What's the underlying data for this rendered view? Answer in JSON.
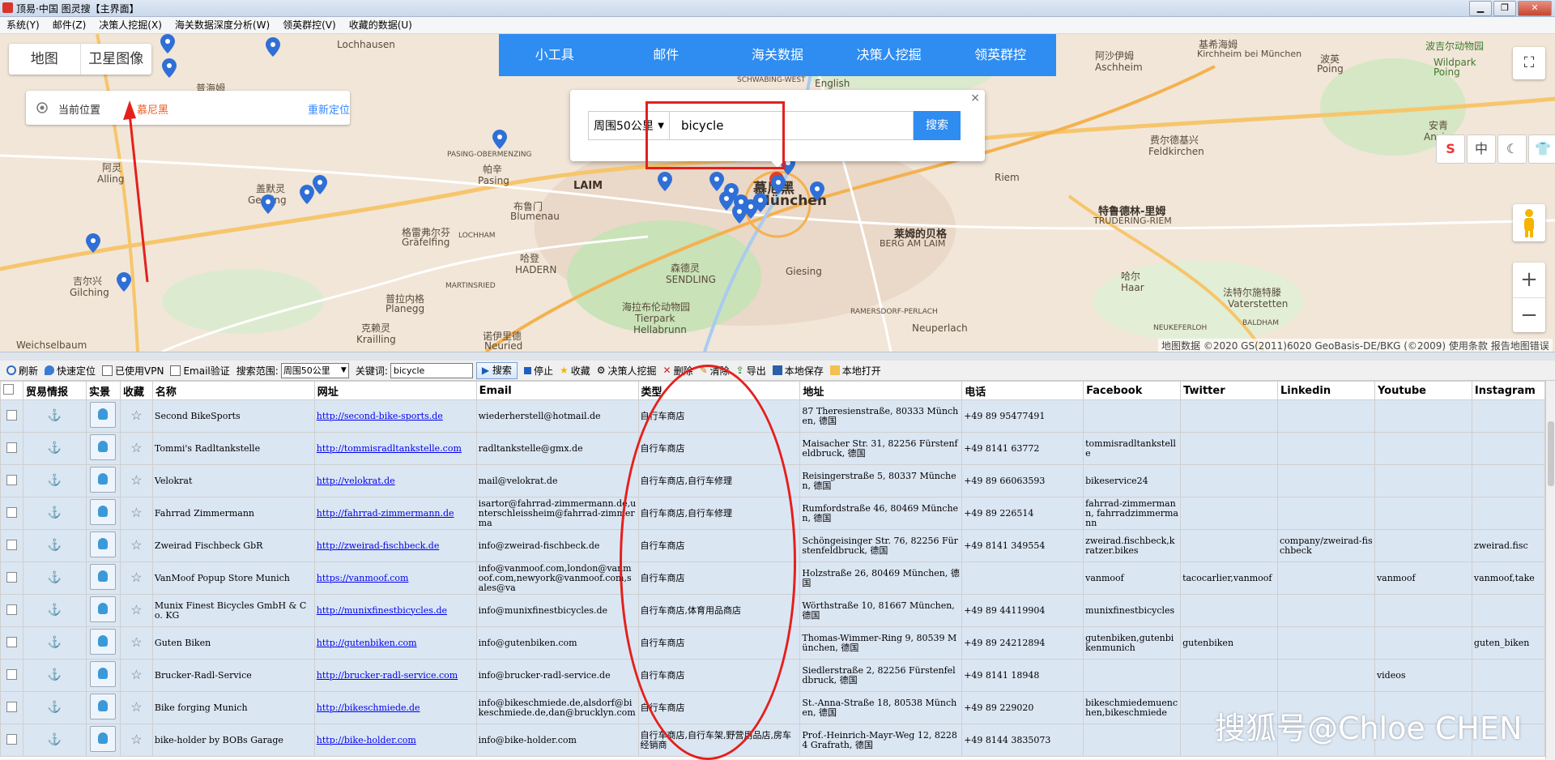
{
  "window": {
    "title": "顶易·中国 图灵搜【主界面】",
    "btn_min": "▁",
    "btn_max": "❐",
    "btn_close": "✕"
  },
  "menu": [
    "系统(Y)",
    "邮件(Z)",
    "决策人挖掘(X)",
    "海关数据深度分析(W)",
    "领英群控(V)",
    "收藏的数据(U)"
  ],
  "map": {
    "type_tabs": [
      "地图",
      "卫星图像"
    ],
    "location_label": "当前位置",
    "location_value": "慕尼黑",
    "relocate": "重新定位",
    "top_nav": [
      "小工具",
      "邮件",
      "海关数据",
      "决策人挖掘",
      "领英群控"
    ],
    "search": {
      "scope": "周围50公里",
      "keyword": "bicycle",
      "button": "搜索",
      "close": "×"
    },
    "side_buttons": [
      "S",
      "中",
      "☾",
      "👕"
    ],
    "zoom_in": "+",
    "zoom_out": "−",
    "fullscreen": "⛶",
    "copyright": "地图数据 ©2020 GS(2011)6020 GeoBasis-DE/BKG (©2009)   使用条款   报告地图错误",
    "labels": [
      "Lochhausen",
      "普海姆",
      "阿灵",
      "Alling",
      "盖默灵",
      "Gerning",
      "吉尔兴",
      "Gilching",
      "Weichselbaum",
      "PASING-OBERMENZING",
      "帕辛",
      "Pasing",
      "LAIM",
      "布鲁门",
      "Blumenau",
      "格雷弗尔芬",
      "Gräfelfing",
      "LOCHHAM",
      "哈登",
      "HADERN",
      "MARTINSRIED",
      "普拉内格",
      "Planegg",
      "克赖灵",
      "Krailling",
      "诺伊里德",
      "Neuried",
      "森德灵",
      "SENDLING",
      "海拉布伦动物园",
      "Tierpark",
      "Hellabrunn",
      "Giesing",
      "慕尼黑",
      "München",
      "SCHWABING-WEST",
      "English",
      "阿沙伊姆",
      "Aschheim",
      "基希海姆",
      "Kirchheim bei München",
      "波英",
      "Poing",
      "费尔德基兴",
      "Feldkirchen",
      "Riem",
      "特鲁德林-里姆",
      "TRUDERING-RIEM",
      "莱姆的贝格",
      "BERG AM LAIM",
      "哈尔",
      "Haar",
      "法特尔施特滕",
      "Vaterstetten",
      "RAMERSDORF-PERLACH",
      "Neuperlach",
      "NEUKEFERLOH",
      "BALDHAM",
      "安青",
      "Anzing",
      "波吉尔动物园",
      "Wildpark",
      "Poing"
    ],
    "pin_color": "#2f6fd6"
  },
  "toolbar": {
    "refresh": "刷新",
    "quick_locate": "快速定位",
    "vpn": "已使用VPN",
    "email_verify": "Email验证",
    "range_label": "搜索范围:",
    "range_value": "周围50公里",
    "keyword_label": "关键词:",
    "keyword_value": "bicycle",
    "search": "搜索",
    "stop": "停止",
    "favorite": "收藏",
    "decision_maker": "决策人挖掘",
    "delete": "删除",
    "clear": "清除",
    "export": "导出",
    "save_local": "本地保存",
    "open_local": "本地打开"
  },
  "table": {
    "headers": [
      "贸易情报",
      "实景",
      "收藏",
      "名称",
      "网址",
      "Email",
      "类型",
      "地址",
      "电话",
      "Facebook",
      "Twitter",
      "Linkedin",
      "Youtube",
      "Instagram"
    ],
    "trade_icon": "⚓",
    "fav_icon": "☆",
    "rows": [
      {
        "name": "Second BikeSports",
        "url": "http://second-bike-sports.de",
        "email": "wiederherstell@hotmail.de",
        "type": "自行车商店",
        "address": "87 Theresienstraße, 80333 München, 德国",
        "phone": "+49 89 95477491",
        "facebook": "",
        "twitter": "",
        "linkedin": "",
        "youtube": "",
        "instagram": ""
      },
      {
        "name": "Tommi's Radltankstelle",
        "url": "http://tommisradltankstelle.com",
        "email": "radltankstelle@gmx.de",
        "type": "自行车商店",
        "address": "Maisacher Str. 31, 82256 Fürstenfeldbruck, 德国",
        "phone": "+49 8141 63772",
        "facebook": "tommisradltankstelle",
        "twitter": "",
        "linkedin": "",
        "youtube": "",
        "instagram": ""
      },
      {
        "name": "Velokrat",
        "url": "http://velokrat.de",
        "email": "mail@velokrat.de",
        "type": "自行车商店,自行车修理",
        "address": "Reisingerstraße 5, 80337 München, 德国",
        "phone": "+49 89 66063593",
        "facebook": "bikeservice24",
        "twitter": "",
        "linkedin": "",
        "youtube": "",
        "instagram": ""
      },
      {
        "name": "Fahrrad Zimmermann",
        "url": "http://fahrrad-zimmermann.de",
        "email": "isartor@fahrrad-zimmermann.de,unterschleissheim@fahrrad-zimmerma",
        "type": "自行车商店,自行车修理",
        "address": "Rumfordstraße 46, 80469 München, 德国",
        "phone": "+49 89 226514",
        "facebook": "fahrrad-zimmermann, fahrradzimmermann",
        "twitter": "",
        "linkedin": "",
        "youtube": "",
        "instagram": ""
      },
      {
        "name": "Zweirad Fischbeck GbR",
        "url": "http://zweirad-fischbeck.de",
        "email": "info@zweirad-fischbeck.de",
        "type": "自行车商店",
        "address": "Schöngeisinger Str. 76, 82256 Fürstenfeldbruck, 德国",
        "phone": "+49 8141 349554",
        "facebook": "zweirad.fischbeck,kratzer.bikes",
        "twitter": "",
        "linkedin": "company/zweirad-fischbeck",
        "youtube": "",
        "instagram": "zweirad.fisc"
      },
      {
        "name": "VanMoof Popup Store Munich",
        "url": "https://vanmoof.com",
        "email": "info@vanmoof.com,london@vanmoof.com,newyork@vanmoof.com,sales@va",
        "type": "自行车商店",
        "address": "Holzstraße 26, 80469 München, 德国",
        "phone": "",
        "facebook": "vanmoof",
        "twitter": "tacocarlier,vanmoof",
        "linkedin": "",
        "youtube": "vanmoof",
        "instagram": "vanmoof,take"
      },
      {
        "name": "Munix Finest Bicycles GmbH & Co. KG",
        "url": "http://munixfinestbicycles.de",
        "email": "info@munixfinestbicycles.de",
        "type": "自行车商店,体育用品商店",
        "address": "Wörthstraße 10, 81667 München, 德国",
        "phone": "+49 89 44119904",
        "facebook": "munixfinestbicycles",
        "twitter": "",
        "linkedin": "",
        "youtube": "",
        "instagram": ""
      },
      {
        "name": "Guten Biken",
        "url": "http://gutenbiken.com",
        "email": "info@gutenbiken.com",
        "type": "自行车商店",
        "address": "Thomas-Wimmer-Ring 9, 80539 München, 德国",
        "phone": "+49 89 24212894",
        "facebook": "gutenbiken,gutenbikenmunich",
        "twitter": "gutenbiken",
        "linkedin": "",
        "youtube": "",
        "instagram": "guten_biken"
      },
      {
        "name": "Brucker-Radl-Service",
        "url": "http://brucker-radl-service.com",
        "email": "info@brucker-radl-service.de",
        "type": "自行车商店",
        "address": "Siedlerstraße 2, 82256 Fürstenfeldbruck, 德国",
        "phone": "+49 8141 18948",
        "facebook": "",
        "twitter": "",
        "linkedin": "",
        "youtube": "videos",
        "instagram": ""
      },
      {
        "name": "Bike forging Munich",
        "url": "http://bikeschmiede.de",
        "email": "info@bikeschmiede.de,alsdorf@bikeschmiede.de,dan@brucklyn.com",
        "type": "自行车商店",
        "address": "St.-Anna-Straße 18, 80538 München, 德国",
        "phone": "+49 89 229020",
        "facebook": "bikeschmiedemuenchen,bikeschmiede",
        "twitter": "",
        "linkedin": "",
        "youtube": "",
        "instagram": ""
      },
      {
        "name": "bike-holder by BOBs Garage",
        "url": "http://bike-holder.com",
        "email": "info@bike-holder.com",
        "type": "自行车商店,自行车架,野营用品店,房车经销商",
        "address": "Prof.-Heinrich-Mayr-Weg 12, 82284 Grafrath, 德国",
        "phone": "+49 8144 3835073",
        "facebook": "",
        "twitter": "",
        "linkedin": "",
        "youtube": "",
        "instagram": ""
      }
    ]
  },
  "watermark": "搜狐号@Chloe CHEN"
}
